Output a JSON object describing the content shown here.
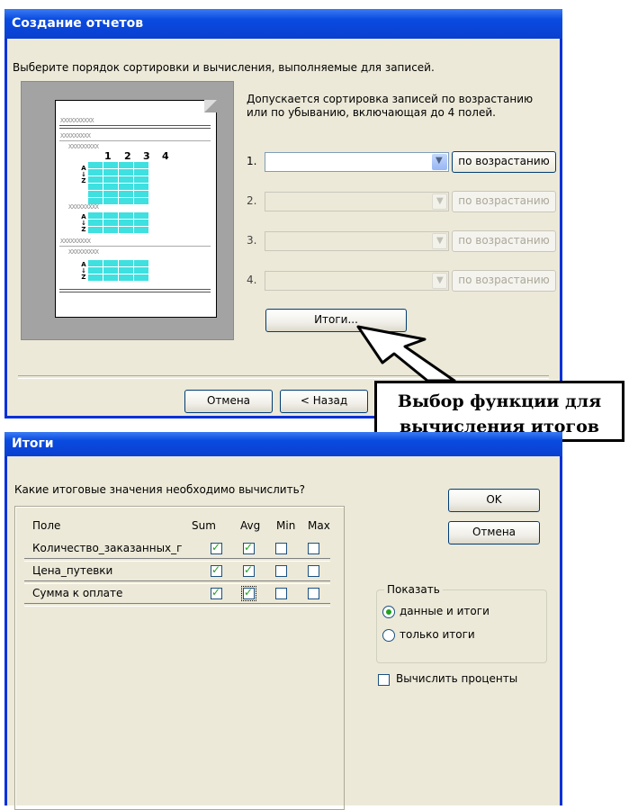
{
  "wizard": {
    "title": "Создание отчетов",
    "prompt": "Выберите порядок сортировки и вычисления, выполняемые для записей.",
    "description": "Допускается сортировка записей по возрастанию или по убыванию, включающая до 4 полей.",
    "preview": {
      "placeholder": "XXXXXXXXXX",
      "placeholder_short": "XXXXXXXXX",
      "col_numbers": [
        "1",
        "2",
        "3",
        "4"
      ],
      "cell_text": "XXXX",
      "sort_glyph": "A\n↓\nZ"
    },
    "sort_rows": [
      {
        "num": "1.",
        "value": "",
        "order": "по возрастанию",
        "enabled": true
      },
      {
        "num": "2.",
        "value": "",
        "order": "по возрастанию",
        "enabled": false
      },
      {
        "num": "3.",
        "value": "",
        "order": "по возрастанию",
        "enabled": false
      },
      {
        "num": "4.",
        "value": "",
        "order": "по возрастанию",
        "enabled": false
      }
    ],
    "summary_button": "Итоги...",
    "cancel_button": "Отмена",
    "back_button": "< Назад"
  },
  "callout": {
    "line1": "Выбор функции для",
    "line2": "вычисления итогов"
  },
  "dialog": {
    "title": "Итоги",
    "question": "Какие итоговые значения необходимо вычислить?",
    "columns": {
      "field": "Поле",
      "sum": "Sum",
      "avg": "Avg",
      "min": "Min",
      "max": "Max"
    },
    "rows": [
      {
        "name": "Количество_заказанных_г",
        "sum": true,
        "avg": true,
        "min": false,
        "max": false
      },
      {
        "name": "Цена_путевки",
        "sum": true,
        "avg": true,
        "min": false,
        "max": false
      },
      {
        "name": "Сумма к оплате",
        "sum": true,
        "avg": true,
        "min": false,
        "max": false
      }
    ],
    "ok_button": "OK",
    "cancel_button": "Отмена",
    "show_group": "Показать",
    "options": [
      {
        "label": "данные и итоги",
        "selected": true
      },
      {
        "label": "только итоги",
        "selected": false
      }
    ],
    "percent_checkbox": {
      "label": "Вычислить проценты",
      "checked": false
    }
  },
  "colors": {
    "titlebar": "#0a4be0",
    "dialog_bg": "#ece9d8",
    "check_green": "#21a121",
    "preview_cell": "#3ee0e0"
  }
}
